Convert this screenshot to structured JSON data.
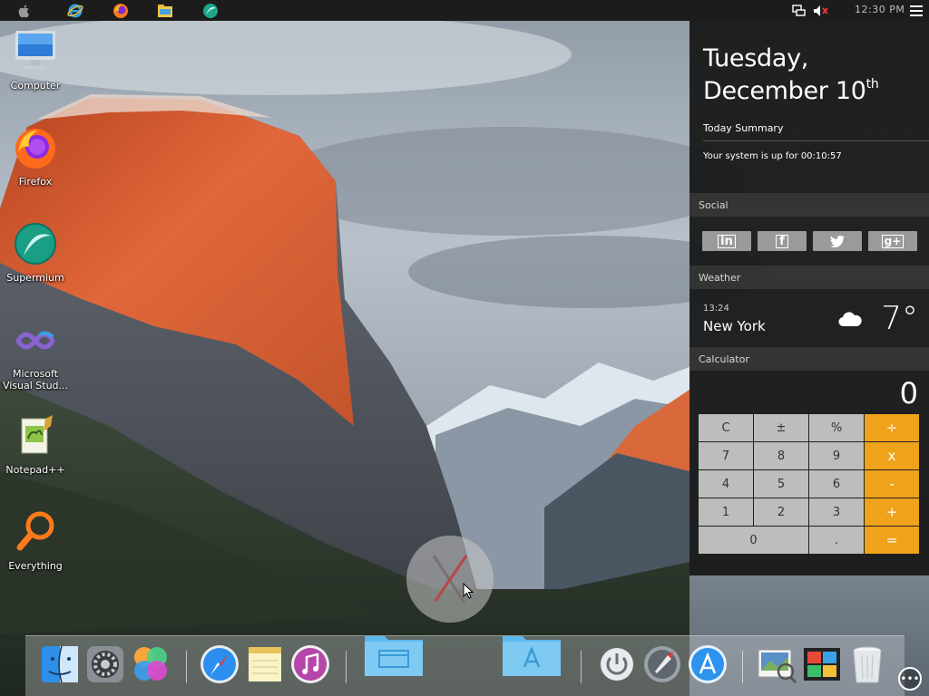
{
  "desktop": {
    "icons": [
      {
        "label": "Computer"
      },
      {
        "label": "Firefox"
      },
      {
        "label": "Supermium"
      },
      {
        "label": "Microsoft Visual Stud..."
      },
      {
        "label": "Notepad++"
      },
      {
        "label": "Everything"
      }
    ]
  },
  "taskbar": {
    "pinned": [
      "apple-icon",
      "internet-explorer-icon",
      "firefox-icon",
      "file-explorer-icon",
      "supermium-icon"
    ],
    "tray": [
      "network-icon",
      "volume-muted-icon",
      "menu-icon"
    ],
    "clock": "12:30 PM"
  },
  "panel": {
    "day": "Tuesday,",
    "month_day": "December 10",
    "ordinal": "th",
    "summary_title": "Today Summary",
    "uptime": "Your system is up for 00:10:57",
    "social": {
      "title": "Social",
      "buttons": [
        "in",
        "f",
        "t",
        "g+"
      ]
    },
    "weather": {
      "title": "Weather",
      "time": "13:24",
      "city": "New York",
      "temp": "7°",
      "icon": "cloud-icon"
    },
    "calculator": {
      "title": "Calculator",
      "display": "0",
      "keys": [
        "C",
        "±",
        "%",
        "÷",
        "7",
        "8",
        "9",
        "x",
        "4",
        "5",
        "6",
        "-",
        "1",
        "2",
        "3",
        "+",
        "0",
        ".",
        "="
      ]
    }
  },
  "dock": {
    "items": [
      "finder-icon",
      "system-preferences-icon",
      "game-center-icon",
      "safari-icon",
      "notes-icon",
      "itunes-icon",
      "documents-folder-icon",
      "applications-folder-icon",
      "power-icon",
      "launchpad-icon",
      "app-store-icon",
      "preview-icon",
      "photo-booth-icon",
      "trash-icon"
    ]
  },
  "colors": {
    "accent_orange": "#f0a21a",
    "panel_bg": "#161616",
    "key_gray": "#bdbdbd"
  }
}
